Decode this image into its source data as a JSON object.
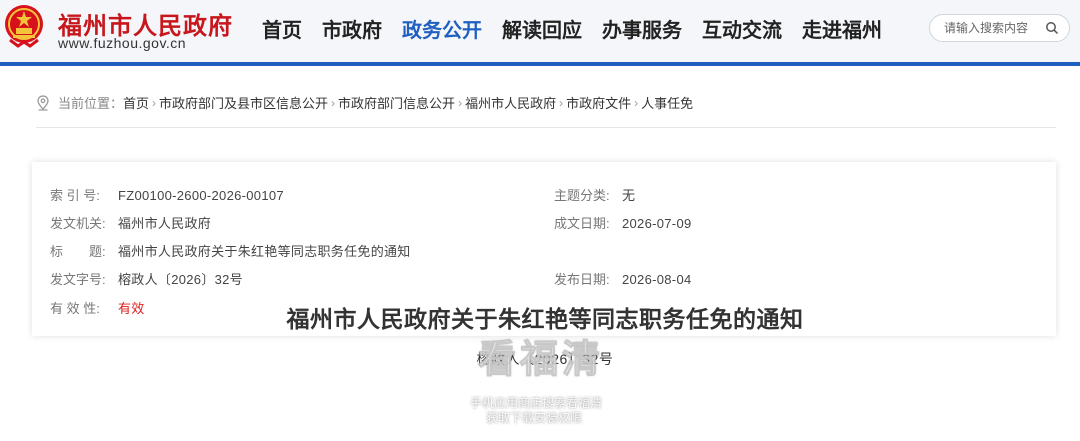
{
  "header": {
    "site_title": "福州市人民政府",
    "site_url": "www.fuzhou.gov.cn",
    "nav": [
      {
        "label": "首页",
        "active": false
      },
      {
        "label": "市政府",
        "active": false
      },
      {
        "label": "政务公开",
        "active": true
      },
      {
        "label": "解读回应",
        "active": false
      },
      {
        "label": "办事服务",
        "active": false
      },
      {
        "label": "互动交流",
        "active": false
      },
      {
        "label": "走进福州",
        "active": false
      }
    ],
    "search_placeholder": "请输入搜索内容"
  },
  "colors": {
    "brand_red": "#c8161d",
    "nav_active_blue": "#1f5fbf",
    "validity_red": "#e02020"
  },
  "breadcrumb": {
    "label": "当前位置：",
    "separator": "›",
    "items": [
      "首页",
      "市政府部门及县市区信息公开",
      "市政府部门信息公开",
      "福州市人民政府",
      "市政府文件",
      "人事任免"
    ]
  },
  "meta": {
    "index_label": "索 引 号:",
    "index_value": "FZ00100-2600-2026-00107",
    "topic_label": "主题分类:",
    "topic_value": "无",
    "issuer_label": "发文机关:",
    "issuer_value": "福州市人民政府",
    "created_label": "成文日期:",
    "created_value": "2026-07-09",
    "title_label": "标　　题:",
    "title_value": "福州市人民政府关于朱红艳等同志职务任免的通知",
    "docno_label": "发文字号:",
    "docno_value": "榕政人〔2026〕32号",
    "published_label": "发布日期:",
    "published_value": "2026-08-04",
    "validity_label": "有 效 性:",
    "validity_value": "有效"
  },
  "document": {
    "title": "福州市人民政府关于朱红艳等同志职务任免的通知",
    "number": "榕政人〔2026〕32号"
  },
  "watermark": {
    "big": "看福清",
    "line1": "手机应用商店搜索看福清",
    "line2": "获取下载安装权限"
  }
}
